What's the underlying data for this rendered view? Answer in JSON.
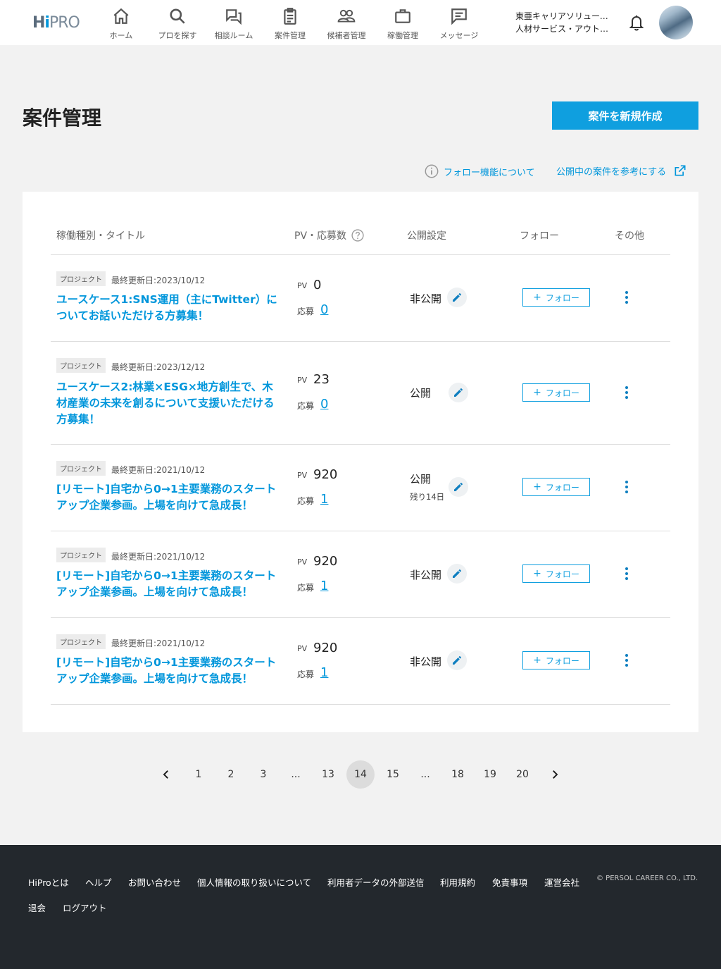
{
  "header": {
    "logo": {
      "part1": "H",
      "part2": "i",
      "part3": "PRO"
    },
    "nav": [
      {
        "label": "ホーム",
        "icon": "home-icon"
      },
      {
        "label": "プロを探す",
        "icon": "search-icon"
      },
      {
        "label": "相談ルーム",
        "icon": "chat-icon"
      },
      {
        "label": "案件管理",
        "icon": "clipboard-icon"
      },
      {
        "label": "候補者管理",
        "icon": "people-icon"
      },
      {
        "label": "稼働管理",
        "icon": "briefcase-icon"
      },
      {
        "label": "メッセージ",
        "icon": "message-icon"
      }
    ],
    "company_line1": "東亜キャリアソリューションズ株式会社",
    "company_line2": "人材サービス・アウトソーシング部"
  },
  "page": {
    "title": "案件管理",
    "create_button": "案件を新規作成",
    "follow_info_link": "フォロー機能について",
    "reference_link": "公開中の案件を参考にする"
  },
  "table": {
    "headers": {
      "title": "稼働種別・タイトル",
      "pv": "PV・応募数",
      "publish": "公開設定",
      "follow": "フォロー",
      "other": "その他"
    },
    "pv_label": "PV",
    "applicants_label": "応募",
    "follow_button": "フォロー",
    "rows": [
      {
        "tag": "プロジェクト",
        "updated": "最終更新日:2023/10/12",
        "title": "ユースケース1:SNS運用（主にTwitter）についてお話いただける方募集！",
        "pv": "0",
        "applicants": "0",
        "status": "非公開",
        "remaining": ""
      },
      {
        "tag": "プロジェクト",
        "updated": "最終更新日:2023/12/12",
        "title": "ユースケース2:林業×ESG×地方創生で、木材産業の未来を創るについて支援いただける方募集！",
        "pv": "23",
        "applicants": "0",
        "status": "公開",
        "remaining": ""
      },
      {
        "tag": "プロジェクト",
        "updated": "最終更新日:2021/10/12",
        "title": "[リモート]自宅から0→1主要業務のスタートアップ企業参画。上場を向けて急成長！",
        "pv": "920",
        "applicants": "1",
        "status": "公開",
        "remaining": "残り14日"
      },
      {
        "tag": "プロジェクト",
        "updated": "最終更新日:2021/10/12",
        "title": "[リモート]自宅から0→1主要業務のスタートアップ企業参画。上場を向けて急成長！",
        "pv": "920",
        "applicants": "1",
        "status": "非公開",
        "remaining": ""
      },
      {
        "tag": "プロジェクト",
        "updated": "最終更新日:2021/10/12",
        "title": "[リモート]自宅から0→1主要業務のスタートアップ企業参画。上場を向けて急成長！",
        "pv": "920",
        "applicants": "1",
        "status": "非公開",
        "remaining": ""
      }
    ]
  },
  "pagination": {
    "pages": [
      "1",
      "2",
      "3",
      "...",
      "13",
      "14",
      "15",
      "...",
      "18",
      "19",
      "20"
    ],
    "current": "14"
  },
  "footer": {
    "links_row1": [
      "HiProとは",
      "ヘルプ",
      "お問い合わせ",
      "個人情報の取り扱いについて",
      "利用者データの外部送信",
      "利用規約",
      "免責事項",
      "運営会社"
    ],
    "links_row2": [
      "退会",
      "ログアウト"
    ],
    "copyright": "© PERSOL CAREER CO., LTD."
  },
  "colors": {
    "accent": "#0f9fdf",
    "link": "#0096db",
    "footer_bg": "#23282d",
    "page_bg": "#f2f2f2"
  }
}
